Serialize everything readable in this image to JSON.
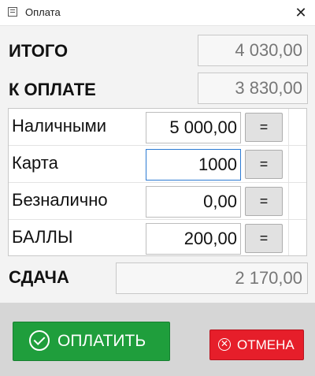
{
  "window": {
    "title": "Оплата",
    "close_icon": "close-icon"
  },
  "totals": {
    "itogo_label": "ИТОГО",
    "itogo_value": "4 030,00",
    "k_oplate_label": "К ОПЛАТЕ",
    "k_oplate_value": "3 830,00"
  },
  "payments": [
    {
      "label": "Наличными",
      "value": "5 000,00",
      "eq_label": "="
    },
    {
      "label": "Карта",
      "value": "1000",
      "eq_label": "="
    },
    {
      "label": "Безналично",
      "value": "0,00",
      "eq_label": "="
    },
    {
      "label": "БАЛЛЫ",
      "value": "200,00",
      "eq_label": "="
    }
  ],
  "change": {
    "label": "СДАЧА",
    "value": "2 170,00"
  },
  "actions": {
    "pay_label": "ОПЛАТИТЬ",
    "cancel_label": "ОТМЕНА"
  },
  "colors": {
    "pay": "#1f9e3c",
    "cancel": "#e61e2a",
    "focus": "#2d7bd3"
  }
}
